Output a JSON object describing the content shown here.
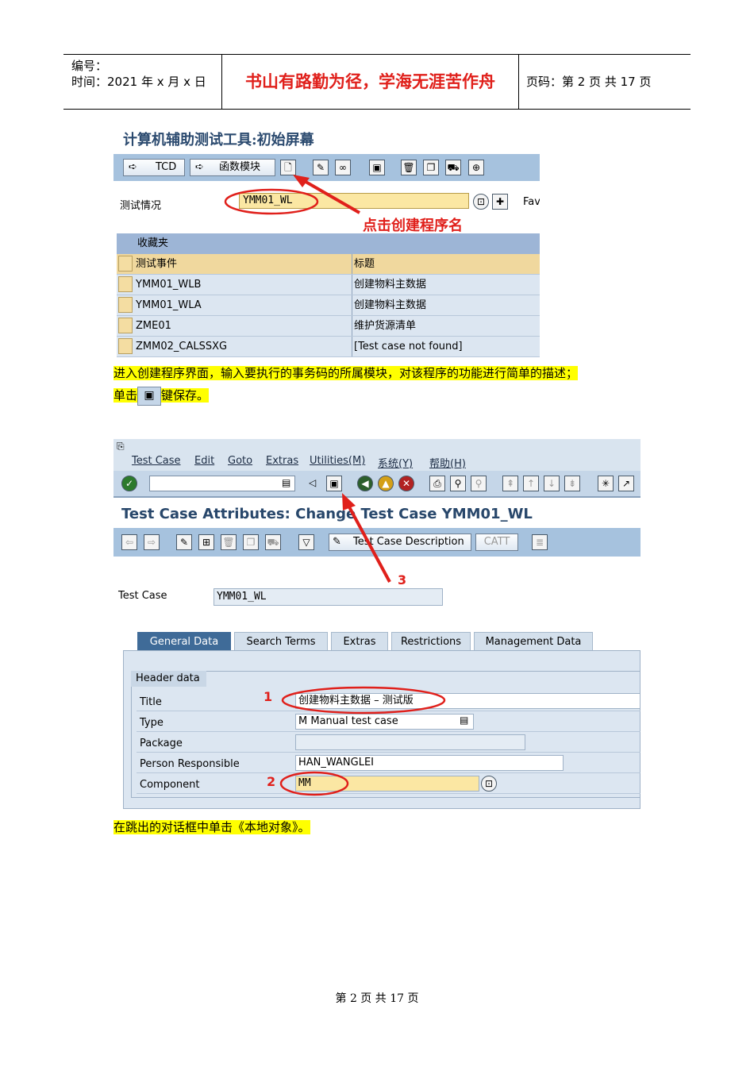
{
  "header": {
    "code_label": "编号：",
    "date_label": "时间：2021 年 x 月 x 日",
    "motto": "书山有路勤为径，学海无涯苦作舟",
    "page_label": "页码：第 2 页  共 17 页"
  },
  "screen1": {
    "title": "计算机辅助测试工具:初始屏幕",
    "btn_tcd": "TCD",
    "btn_func": "函数模块",
    "field_label": "测试情况",
    "field_value": "YMM01_WL",
    "fav_label": "Fav",
    "annotation": "点击创建程序名",
    "fav_header": "收藏夹",
    "col_event": "测试事件",
    "col_title": "标题",
    "rows": [
      {
        "event": "YMM01_WLB",
        "title": "创建物料主数据"
      },
      {
        "event": "YMM01_WLA",
        "title": "创建物料主数据"
      },
      {
        "event": "ZME01",
        "title": "维护货源清单"
      },
      {
        "event": "ZMM02_CALSSXG",
        "title": "[Test case not found]"
      }
    ]
  },
  "para1_line1": "进入创建程序界面，输入要执行的事务码的所属模块，对该程序的功能进行简单的描述；",
  "para1_line2a": "单击",
  "para1_line2b": "键保存。",
  "screen2": {
    "menus": [
      "Test Case",
      "Edit",
      "Goto",
      "Extras",
      "Utilities(M)",
      "系统(Y)",
      "帮助(H)"
    ],
    "page_title": "Test Case Attributes: Change Test Case YMM01_WL",
    "btn_desc": "Test Case Description",
    "btn_catt": "CATT",
    "tc_label": "Test Case",
    "tc_value": "YMM01_WL",
    "tabs": [
      "General Data",
      "Search Terms",
      "Extras",
      "Restrictions",
      "Management Data"
    ],
    "group_title": "Header data",
    "fields": {
      "title_label": "Title",
      "title_value": "创建物料主数据 – 测试版",
      "type_label": "Type",
      "type_value": "M Manual test case",
      "package_label": "Package",
      "package_value": "",
      "person_label": "Person Responsible",
      "person_value": "HAN_WANGLEI",
      "component_label": "Component",
      "component_value": "MM"
    },
    "marker1": "1",
    "marker2": "2",
    "marker3": "3"
  },
  "para2": "在跳出的对话框中单击《本地对象》。",
  "footer": "第 2 页 共 17 页",
  "colors": {
    "accent_red": "#e0201b",
    "highlight": "#ffff00",
    "sap_blue": "#a6c2de"
  }
}
